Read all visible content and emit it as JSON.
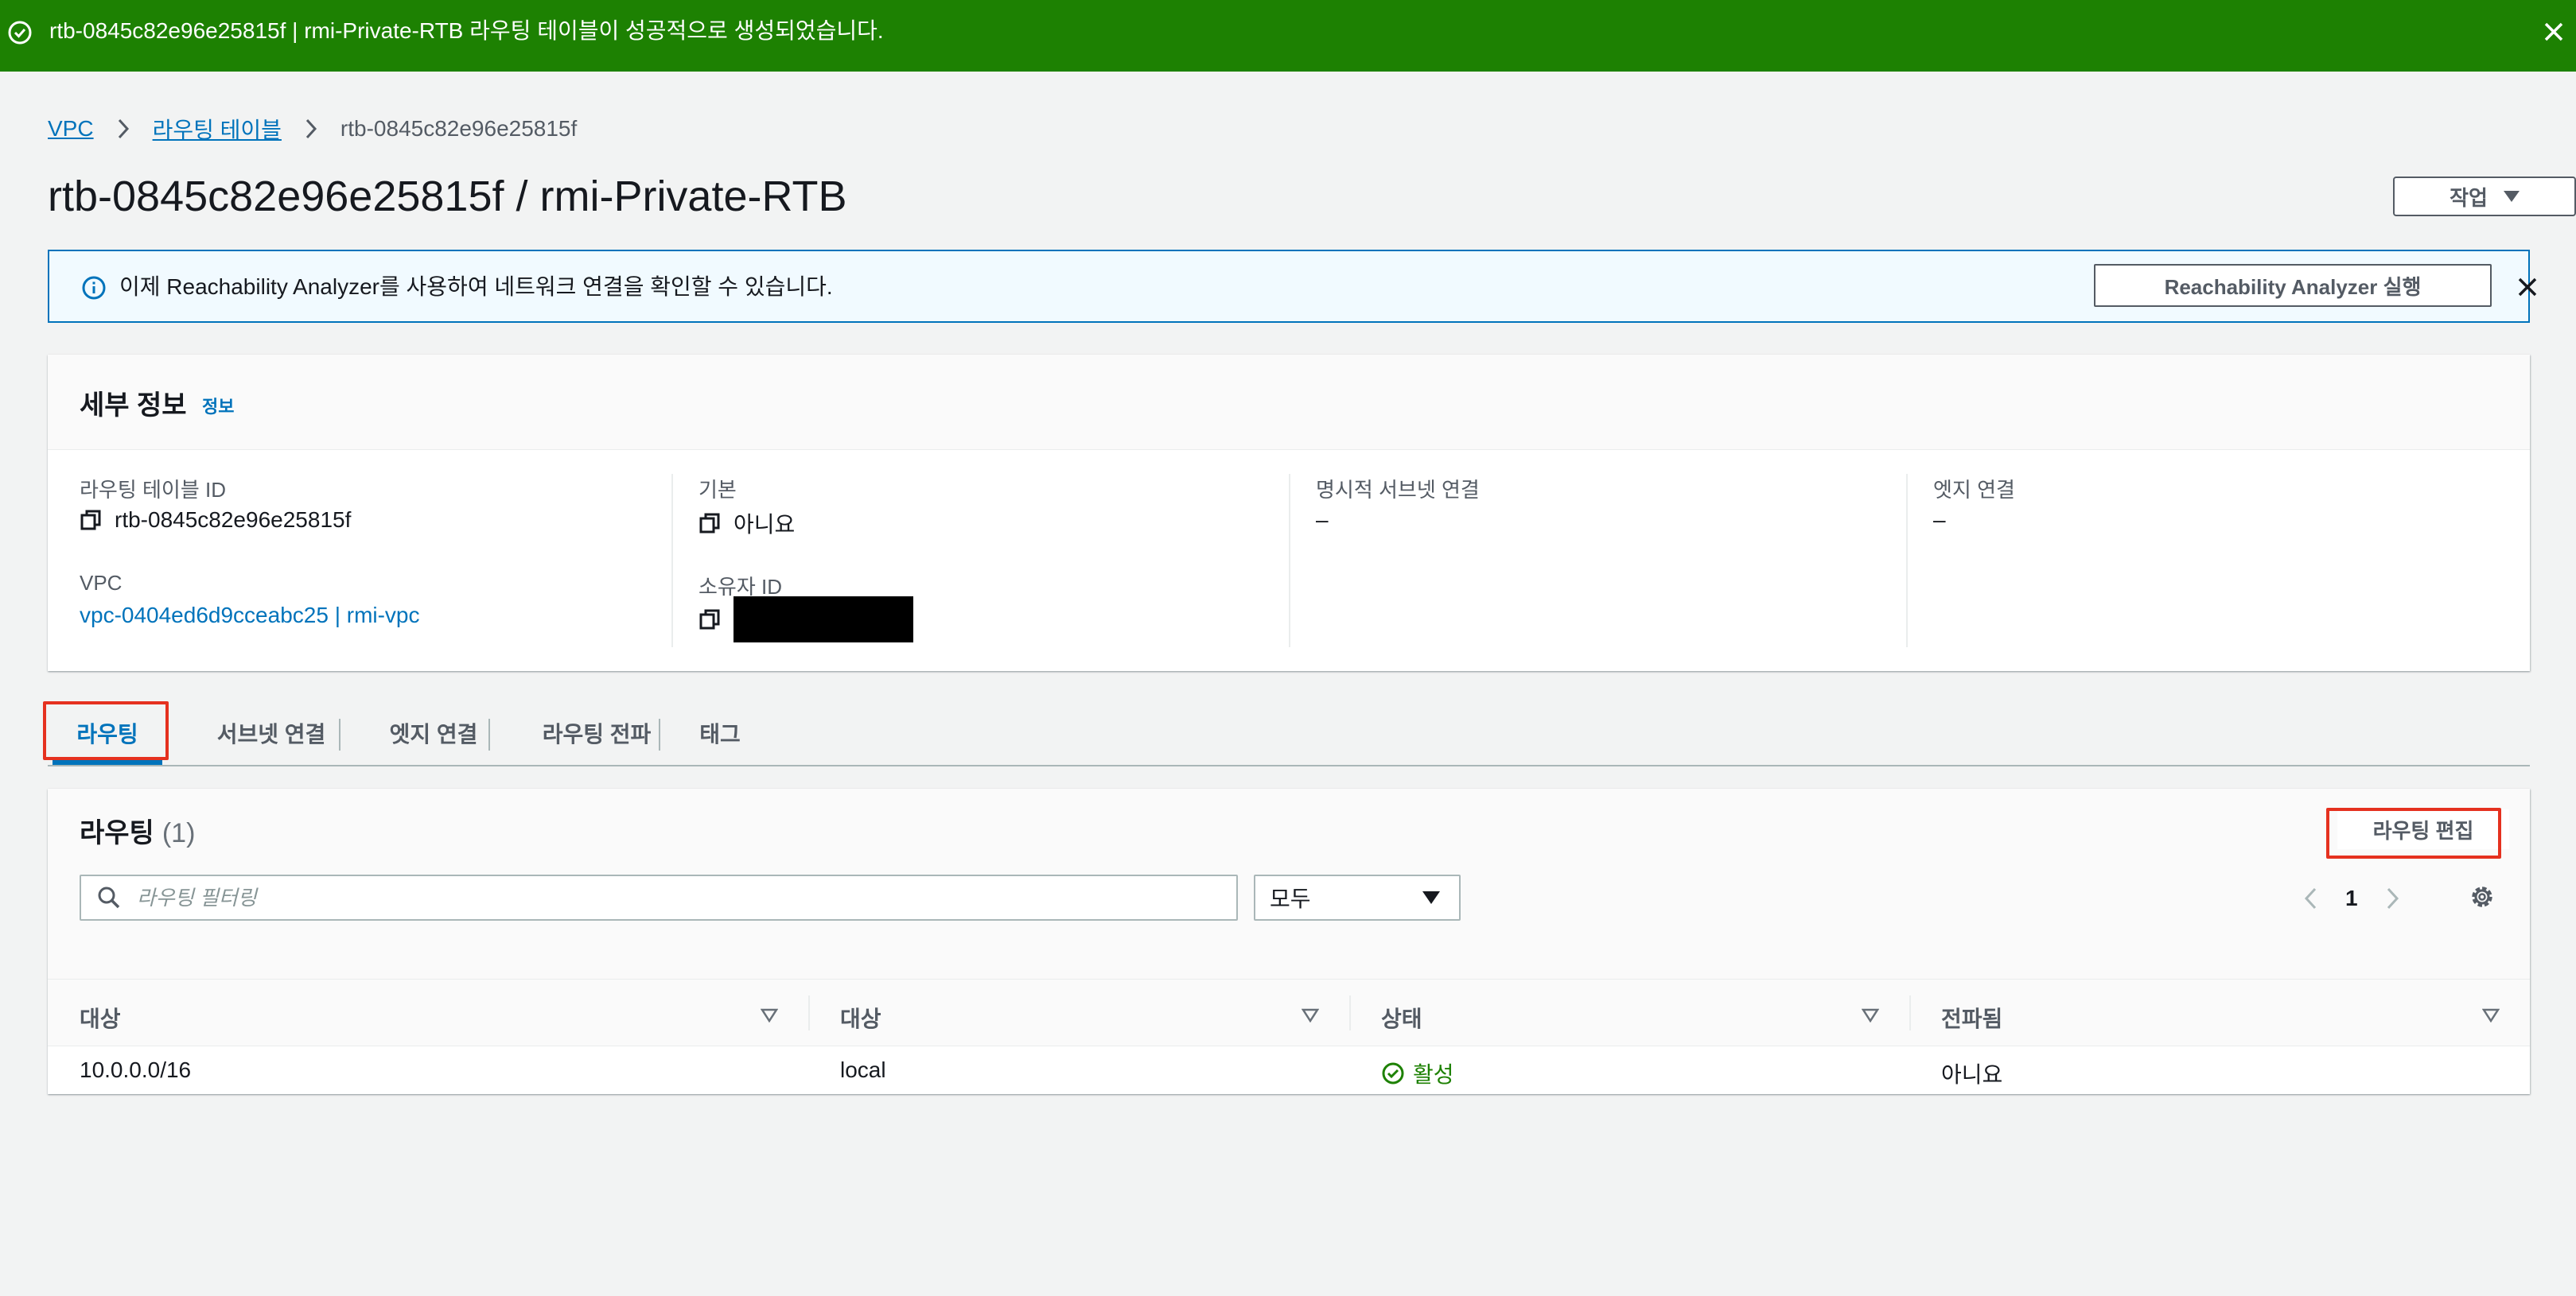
{
  "flash": {
    "message": "rtb-0845c82e96e25815f | rmi-Private-RTB 라우팅 테이블이 성공적으로 생성되었습니다."
  },
  "breadcrumb": {
    "items": [
      "VPC",
      "라우팅 테이블"
    ],
    "current": "rtb-0845c82e96e25815f"
  },
  "page": {
    "title": "rtb-0845c82e96e25815f / rmi-Private-RTB",
    "action_label": "작업"
  },
  "alert": {
    "text": "이제 Reachability Analyzer를 사용하여 네트워크 연결을 확인할 수 있습니다.",
    "button_label": "Reachability Analyzer 실행"
  },
  "details": {
    "title": "세부 정보",
    "info_link": "정보",
    "route_table_id_label": "라우팅 테이블 ID",
    "route_table_id": "rtb-0845c82e96e25815f",
    "vpc_label": "VPC",
    "vpc_value": "vpc-0404ed6d9cceabc25 | rmi-vpc",
    "main_label": "기본",
    "main_value": "아니요",
    "owner_label": "소유자 ID",
    "explicit_subnet_label": "명시적 서브넷 연결",
    "explicit_subnet_value": "–",
    "edge_label": "엣지 연결",
    "edge_value": "–"
  },
  "tabs": [
    "라우팅",
    "서브넷 연결",
    "엣지 연결",
    "라우팅 전파",
    "태그"
  ],
  "routes": {
    "title": "라우팅",
    "count": "(1)",
    "edit_label": "라우팅 편집",
    "filter_placeholder": "라우팅 필터링",
    "select_value": "모두",
    "page": "1",
    "columns": [
      "대상",
      "대상",
      "상태",
      "전파됨"
    ],
    "rows": [
      {
        "destination": "10.0.0.0/16",
        "target": "local",
        "status": "활성",
        "propagated": "아니요"
      }
    ]
  },
  "colors": {
    "success": "#1d8102",
    "link": "#0073bb",
    "highlight": "#e5311f"
  }
}
